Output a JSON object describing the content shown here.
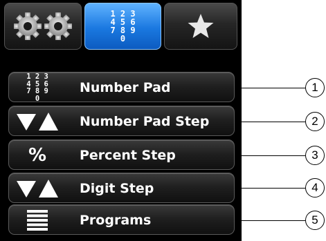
{
  "tabs": [
    {
      "id": "settings",
      "icon": "gears-icon",
      "active": false
    },
    {
      "id": "number-pad",
      "icon": "numpad-icon",
      "glyph": "1 2 3\n4 5 6\n7 8 9\n0",
      "active": true
    },
    {
      "id": "favorites",
      "icon": "star-icon",
      "active": false
    }
  ],
  "menu": {
    "items": [
      {
        "label": "Number Pad",
        "icon": "numpad-icon",
        "glyph": "1 2 3\n4 5 6\n7 8 9\n0"
      },
      {
        "label": "Number Pad Step",
        "icon": "step-arrows-icon"
      },
      {
        "label": "Percent Step",
        "icon": "percent-icon",
        "glyph": "%"
      },
      {
        "label": "Digit Step",
        "icon": "step-arrows-icon"
      },
      {
        "label": "Programs",
        "icon": "list-icon"
      }
    ]
  },
  "callouts": [
    "1",
    "2",
    "3",
    "4",
    "5"
  ],
  "colors": {
    "active_tab": "#1a78e0",
    "panel_bg": "#000000",
    "text": "#ffffff"
  }
}
